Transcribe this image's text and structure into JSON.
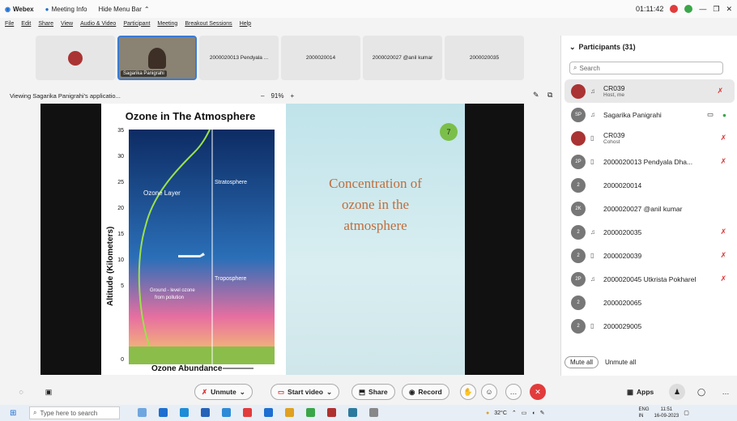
{
  "titlebar": {
    "app": "Webex",
    "meeting_info": "Meeting Info",
    "hide_menu": "Hide Menu Bar",
    "timer": "01:11:42"
  },
  "menu": [
    "File",
    "Edit",
    "Share",
    "View",
    "Audio & Video",
    "Participant",
    "Meeting",
    "Breakout Sessions",
    "Help"
  ],
  "thumbnails": [
    {
      "label": ""
    },
    {
      "label": "Sagarika Panigrahi"
    },
    {
      "label": "2000020013 Pendyala ..."
    },
    {
      "label": "2000020014"
    },
    {
      "label": "2000020027 @anil kumar"
    },
    {
      "label": "2000020035"
    }
  ],
  "viewing": "Viewing Sagarika Panigrahi's applicatio...",
  "zoom": {
    "minus": "–",
    "value": "91%",
    "plus": "+"
  },
  "slide": {
    "title": "Ozone in The Atmosphere",
    "ylabel": "Altitude (Kilometers)",
    "yticks": [
      "35",
      "30",
      "25",
      "20",
      "15",
      "10",
      "5",
      "0"
    ],
    "ozone_layer": "Ozone Layer",
    "stratosphere": "Stratosphere",
    "troposphere": "Troposphere",
    "ground_level": "Ground - level ozone",
    "from_pollution": "from pollution",
    "xlabel": "Ozone Abundance",
    "badge": "7",
    "concept_lines": [
      "Concentration of",
      "ozone in the",
      "atmosphere"
    ]
  },
  "panel": {
    "header": "Participants (31)",
    "search_placeholder": "Search",
    "participants": [
      {
        "initials": "",
        "name": "CR039",
        "sub": "Host, me",
        "icon": "headset-icon",
        "muted": true,
        "logo": true
      },
      {
        "initials": "SP",
        "name": "Sagarika Panigrahi",
        "sub": "",
        "icon": "headset-icon",
        "muted": false,
        "logo": false
      },
      {
        "initials": "",
        "name": "CR039",
        "sub": "Cohost",
        "icon": "phone-icon",
        "muted": true,
        "logo": true
      },
      {
        "initials": "2P",
        "name": "2000020013 Pendyala  Dha...",
        "sub": "",
        "icon": "phone-icon",
        "muted": true,
        "logo": false
      },
      {
        "initials": "2",
        "name": "2000020014",
        "sub": "",
        "icon": "",
        "muted": false,
        "logo": false
      },
      {
        "initials": "2K",
        "name": "2000020027 @anil kumar",
        "sub": "",
        "icon": "",
        "muted": false,
        "logo": false
      },
      {
        "initials": "2",
        "name": "2000020035",
        "sub": "",
        "icon": "headset-icon",
        "muted": true,
        "logo": false
      },
      {
        "initials": "2",
        "name": "2000020039",
        "sub": "",
        "icon": "phone-icon",
        "muted": true,
        "logo": false
      },
      {
        "initials": "2P",
        "name": "2000020045 Utkrista Pokharel",
        "sub": "",
        "icon": "headset-icon",
        "muted": true,
        "logo": false
      },
      {
        "initials": "2",
        "name": "2000020065",
        "sub": "",
        "icon": "",
        "muted": false,
        "logo": false
      },
      {
        "initials": "2",
        "name": "2000029005",
        "sub": "",
        "icon": "phone-icon",
        "muted": true,
        "logo": false
      }
    ],
    "mute_all": "Mute all",
    "unmute_all": "Unmute all"
  },
  "controls": {
    "unmute": "Unmute",
    "start_video": "Start video",
    "share": "Share",
    "record": "Record",
    "apps": "Apps"
  },
  "taskbar": {
    "search": "Type here to search",
    "temp": "32°C",
    "lang": "ENG",
    "region": "IN",
    "time": "11:51",
    "date": "16-09-2023"
  }
}
